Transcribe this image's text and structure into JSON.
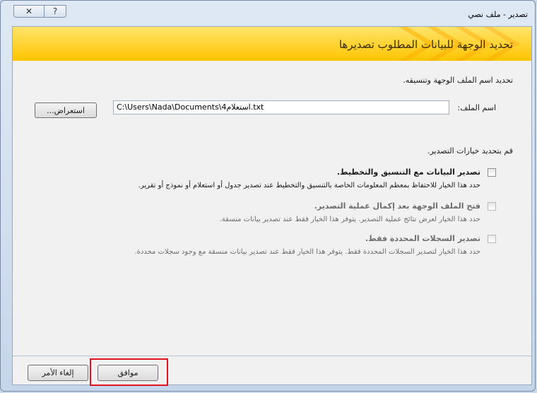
{
  "window": {
    "title": "تصدير - ملف نصي",
    "close_icon": "✕",
    "help_icon": "?"
  },
  "banner": {
    "text": "تحديد الوجهة للبيانات المطلوب تصديرها"
  },
  "instructions": "تحديد اسم الملف الوجهة وتنسيقه.",
  "file_name": {
    "label": "اسم الملف:",
    "value": "C:\\Users\\Nada\\Documents\\استعلام4.txt"
  },
  "browse_label": "استعراض...",
  "options_label": "قم بتحديد خيارات التصدير.",
  "options": [
    {
      "title": "تصدير البيانات مع التنسيق والتخطيط.",
      "desc": "حدد هذا الخيار للاحتفاظ بمعظم المعلومات الخاصة بالتنسيق والتخطيط عند تصدير جدول أو استعلام أو نموذج أو تقرير.",
      "checked": false,
      "enabled": true
    },
    {
      "title": "فتح الملف الوجهة بعد إكمال عملية التصدير.",
      "desc": "حدد هذا الخيار لعرض نتائج عملية التصدير. يتوفر هذا الخيار فقط عند تصدير بيانات منسقة.",
      "checked": false,
      "enabled": false
    },
    {
      "title": "تصدير السجلات المحددة فقط.",
      "desc": "حدد هذا الخيار لتصدير السجلات المحددة فقط. يتوفر هذا الخيار فقط عند تصدير بيانات منسقة مع وجود سجلات محددة.",
      "checked": false,
      "enabled": false
    }
  ],
  "buttons": {
    "ok": "موافق",
    "cancel": "إلغاء الأمر"
  },
  "colors": {
    "banner": "#ffc400",
    "highlight": "#e0141e"
  }
}
